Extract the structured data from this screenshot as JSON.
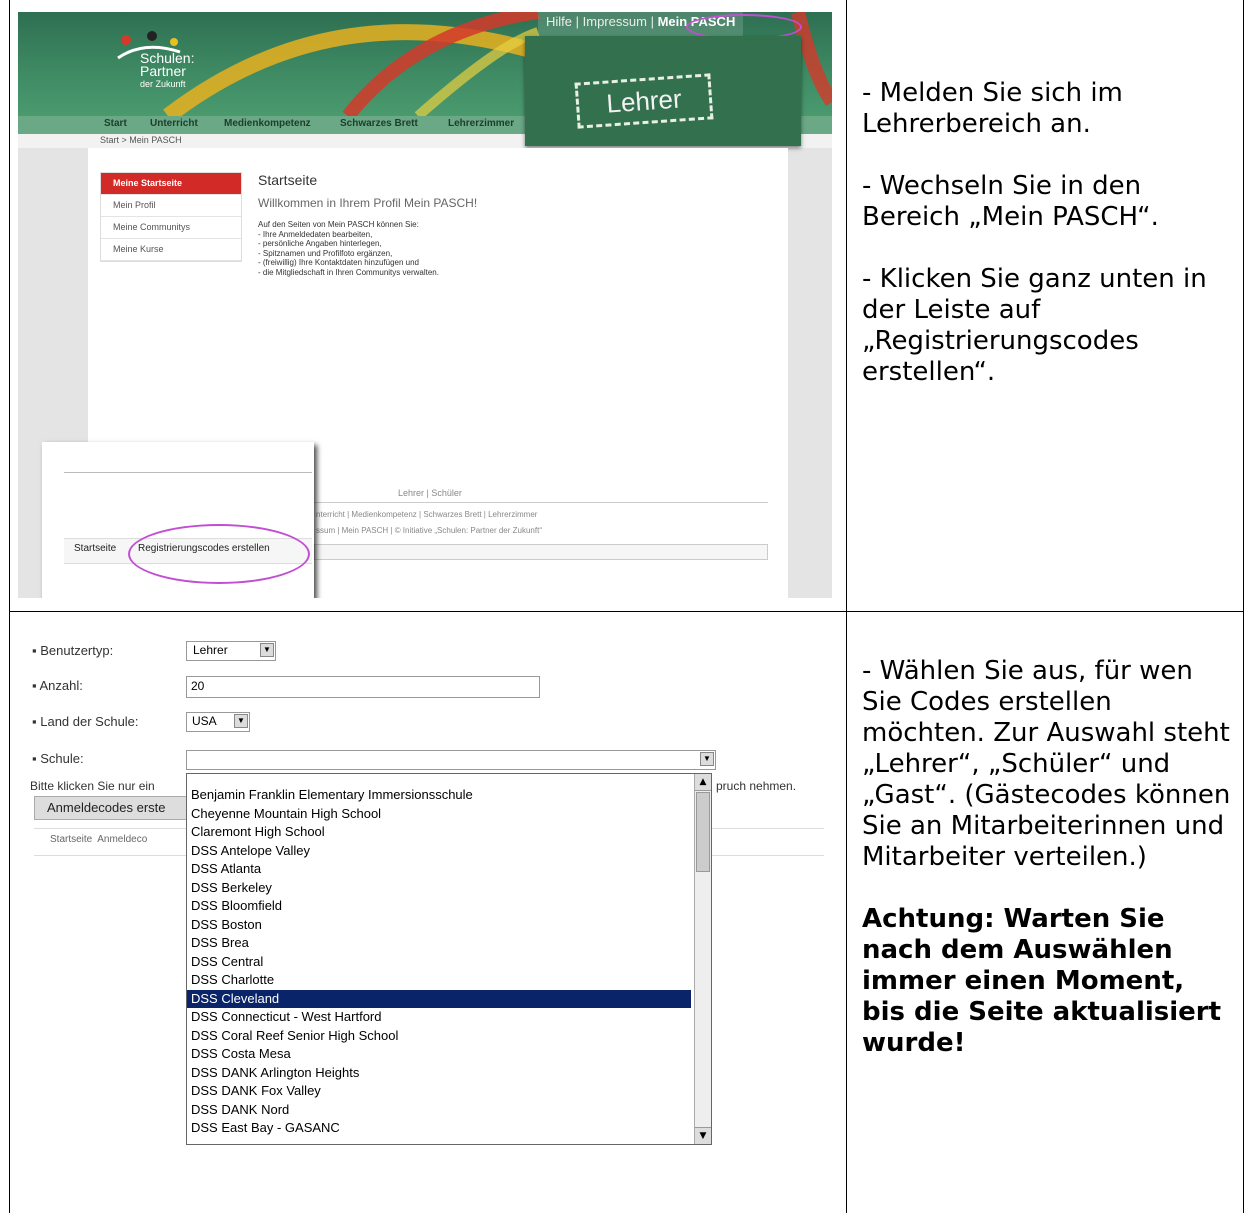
{
  "shot1": {
    "logo": {
      "line1": "Schulen:",
      "line2": "Partner",
      "line3": "der Zukunft"
    },
    "top_links": [
      "Hilfe",
      "Impressum",
      "Mein PASCH"
    ],
    "stamp": "Lehrer",
    "nav": [
      "Start",
      "Unterricht",
      "Medienkompetenz",
      "Schwarzes Brett",
      "Lehrerzimmer"
    ],
    "breadcrumb": "Start > Mein PASCH",
    "menu": [
      "Meine Startseite",
      "Mein Profil",
      "Meine Communitys",
      "Meine Kurse"
    ],
    "page_title": "Startseite",
    "welcome": "Willkommen in Ihrem Profil Mein PASCH!",
    "intro": "Auf den Seiten von Mein PASCH können Sie:",
    "bullets": [
      "- Ihre Anmeldedaten bearbeiten,",
      "- persönliche Angaben hinterlegen,",
      "- Spitznamen und Profilfoto ergänzen,",
      "- (freiwillig) Ihre Kontaktdaten hinzufügen und",
      "- die Mitgliedschaft in Ihren Communitys verwalten."
    ],
    "footer_line1": "Lehrer | Schüler",
    "footer_line2": "nterricht | Medienkompetenz | Schwarzes Brett | Lehrerzimmer",
    "footer_line3": "ssum | Mein PASCH | © Initiative „Schulen: Partner der Zukunft“",
    "popup_btn1": "Startseite",
    "popup_btn2": "Registrierungscodes erstellen"
  },
  "shot2": {
    "benutzertyp_label": "Benutzertyp:",
    "benutzertyp_value": "Lehrer",
    "anzahl_label": "Anzahl:",
    "anzahl_value": "20",
    "land_label": "Land der Schule:",
    "land_value": "USA",
    "schule_label": "Schule:",
    "hint_left": "Bitte klicken Sie nur ein",
    "hint_right": "pruch nehmen.",
    "button_label": "Anmeldecodes erste",
    "bottom_left": "Startseite  Anmeldeco",
    "schools": [
      "Benjamin Franklin Elementary Immersionsschule",
      "Cheyenne Mountain High School",
      "Claremont High School",
      "DSS Antelope Valley",
      "DSS Atlanta",
      "DSS Berkeley",
      "DSS Bloomfield",
      "DSS Boston",
      "DSS Brea",
      "DSS Central",
      "DSS Charlotte",
      "DSS Cleveland",
      "DSS Connecticut - West Hartford",
      "DSS Coral Reef Senior High School",
      "DSS Costa Mesa",
      "DSS DANK Arlington Heights",
      "DSS DANK Fox Valley",
      "DSS DANK Nord",
      "DSS East Bay - GASANC"
    ],
    "selected_school": "DSS Cleveland"
  },
  "instructions": {
    "step1": "- Melden Sie sich im Lehrerbereich an.",
    "step2": "- Wechseln Sie in den Bereich „Mein PASCH“.",
    "step3": "- Klicken Sie ganz unten in der Leiste auf „Registrierungscodes erstellen“.",
    "step4": "- Wählen Sie aus, für wen Sie Codes erstellen möchten. Zur Auswahl steht „Lehrer“, „Schüler“ und „Gast“. (Gästecodes können Sie an Mitarbeiterinnen und Mitarbeiter verteilen.)",
    "warning": "Achtung: Warten Sie nach dem Auswählen immer einen Moment, bis die Seite aktualisiert wurde!"
  }
}
